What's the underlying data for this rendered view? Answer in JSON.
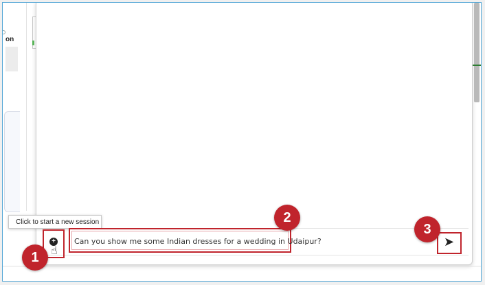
{
  "left_panel": {
    "label": "on"
  },
  "composer": {
    "tooltip": "Click to start a new session",
    "message_value": "Can you show me some Indian dresses for a wedding in Udaipur?"
  },
  "icons": {
    "new_session": "chat-plus-icon",
    "cursor": "hand-cursor-icon",
    "send": "send-icon"
  },
  "steps": [
    "1",
    "2",
    "3"
  ],
  "colors": {
    "highlight": "#c0242c",
    "frame_border": "#54a7d6"
  }
}
